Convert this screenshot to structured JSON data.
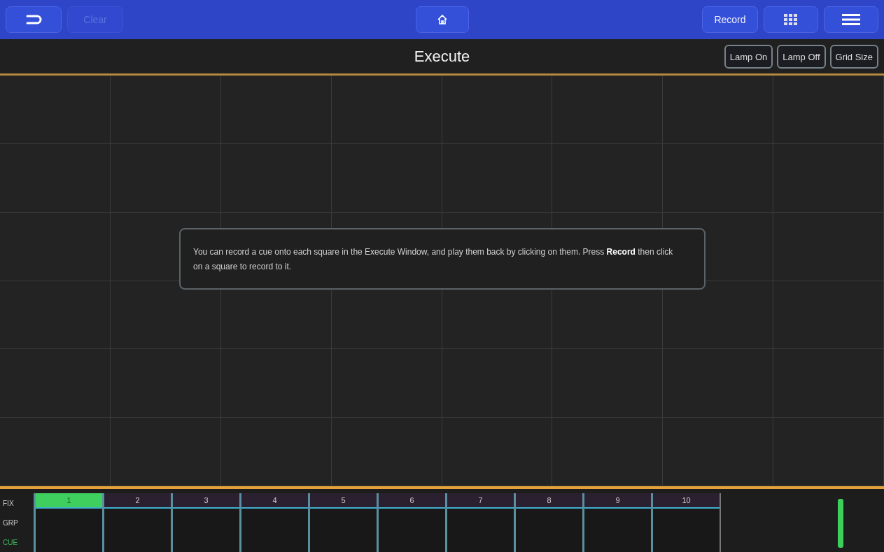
{
  "toolbar": {
    "clear": {
      "label": "Clear",
      "disabled": true
    },
    "record": {
      "label": "Record"
    }
  },
  "header": {
    "title": "Execute",
    "buttons": [
      "Lamp On",
      "Lamp Off",
      "Grid Size"
    ]
  },
  "grid": {
    "message": "You can record a cue onto each square in the Execute Window, and play them back by clicking on them. Press **Record** then click on a square to record to it."
  },
  "playbacks": {
    "side_labels": [
      {
        "label": "FIX",
        "selected": false
      },
      {
        "label": "GRP",
        "selected": false
      },
      {
        "label": "CUE",
        "selected": true
      }
    ],
    "items": [
      {
        "label": "1",
        "selected": true
      },
      {
        "label": "2",
        "selected": false
      },
      {
        "label": "3",
        "selected": false
      },
      {
        "label": "4",
        "selected": false
      },
      {
        "label": "5",
        "selected": false
      },
      {
        "label": "6",
        "selected": false
      },
      {
        "label": "7",
        "selected": false
      },
      {
        "label": "8",
        "selected": false
      },
      {
        "label": "9",
        "selected": false
      },
      {
        "label": "10",
        "selected": false
      }
    ]
  }
}
